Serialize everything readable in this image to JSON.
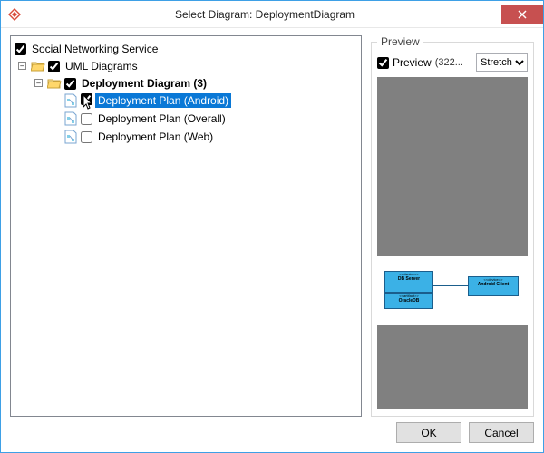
{
  "titlebar": {
    "title": "Select Diagram: DeploymentDiagram"
  },
  "tree": {
    "root": {
      "label": "Social Networking Service",
      "children": {
        "uml": {
          "label": "UML Diagrams",
          "children": {
            "deploy": {
              "label": "Deployment Diagram (3)",
              "items": {
                "android": "Deployment Plan (Android)",
                "overall": "Deployment Plan (Overall)",
                "web": "Deployment Plan (Web)"
              }
            }
          }
        }
      }
    }
  },
  "preview": {
    "legend": "Preview",
    "checkbox_label": "Preview",
    "dimensions": "(322...",
    "select_value": "Stretch",
    "diagram": {
      "db_stereo": "<<device>>",
      "db_name": "DB Server",
      "artifact_stereo": "<<artifact>>",
      "artifact_name": "OracleDB",
      "client_stereo": "<<device>>",
      "client_name": "Android Client"
    }
  },
  "buttons": {
    "ok": "OK",
    "cancel": "Cancel"
  }
}
